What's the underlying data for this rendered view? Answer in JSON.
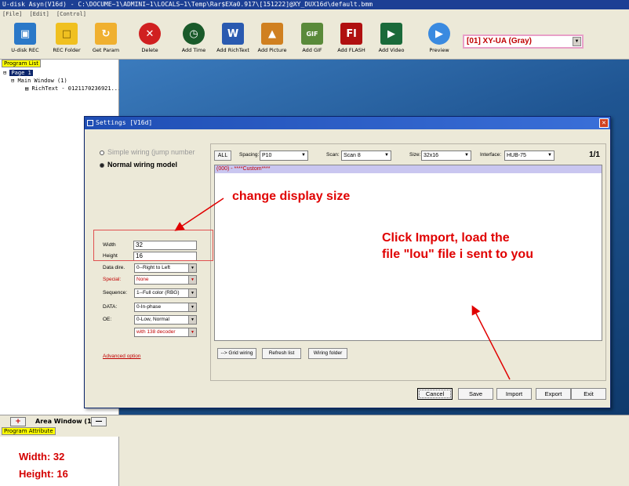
{
  "window": {
    "title": "U-disk Asyn(V16d) - C:\\DOCUME~1\\ADMINI~1\\LOCALS~1\\Temp\\Rar$EXa0.917\\[151222]@XY_DUX16d\\default.bmm",
    "menu": [
      "[File]",
      "[Edit]",
      "[Control]"
    ]
  },
  "toolbar": {
    "buttons": [
      {
        "label": "U-disk REC",
        "icon": "usb-disk-icon"
      },
      {
        "label": "REC Folder",
        "icon": "folder-icon"
      },
      {
        "label": "Get Param",
        "icon": "get-param-icon"
      },
      {
        "label": "Delete",
        "icon": "delete-icon"
      },
      {
        "label": "Add Time",
        "icon": "clock-icon"
      },
      {
        "label": "Add RichText",
        "icon": "word-doc-icon"
      },
      {
        "label": "Add Picture",
        "icon": "picture-icon"
      },
      {
        "label": "Add GIF",
        "icon": "gif-icon"
      },
      {
        "label": "Add FLASH",
        "icon": "flash-icon"
      },
      {
        "label": "Add Video",
        "icon": "video-icon"
      },
      {
        "label": "Preview",
        "icon": "play-icon"
      }
    ],
    "model_select": "[01]  XY-UA (Gray)"
  },
  "program_list": {
    "tag": "Program List",
    "tree": [
      "Page 1",
      "Main Window  (1)",
      "RichText - 0121170236921..."
    ]
  },
  "area_window": {
    "label": "Area Window (1)",
    "add": "+",
    "remove": "—"
  },
  "program_attribute": {
    "tag": "Program Attribute"
  },
  "dialog": {
    "title": "Settings [V16d]",
    "close": "✕",
    "wiring": {
      "simple": "Simple wiring (jump number",
      "normal": "Normal wiring model"
    },
    "fields": {
      "width_label": "Width",
      "width_value": "32",
      "height_label": "Height",
      "height_value": "16",
      "data_dire_label": "Data dire.",
      "data_dire_value": "0--Right to Left",
      "special_label": "Special:",
      "special_value": "None",
      "sequence_label": "Sequence:",
      "sequence_value": "1--Full color (RBG)",
      "data_label": "DATA:",
      "data_value": "0-In-phase",
      "oe_label": "OE:",
      "oe_value": "0-Low, Normal",
      "decoder_value": "with 138 decoder"
    },
    "advanced": "Advanced option",
    "controls": {
      "all": "ALL",
      "spacing_label": "Spacing:",
      "spacing_value": "P10",
      "scan_label": "Scan:",
      "scan_value": "Scan 8",
      "size_label": "Size:",
      "size_value": "32x16",
      "interface_label": "Interface:",
      "interface_value": "HUB-75",
      "page": "1/1"
    },
    "list_row": "(000) - ****Custom****",
    "bottom_buttons": [
      "--> Grid wiring",
      "Refresh list",
      "Wiring folder"
    ],
    "actions": [
      "Cancel",
      "Save",
      "Import",
      "Export",
      "Exit"
    ]
  },
  "annotations": {
    "size_note": "change display size",
    "import_line1": "Click Import,  load the",
    "import_line2": "file \"lou\" file i sent to you",
    "width_note": "Width:  32",
    "height_note": "Height: 16"
  },
  "colors": {
    "annotation_red": "#e00000",
    "title_blue": "#1c3f94",
    "list_highlight": "#c9c6f0"
  }
}
